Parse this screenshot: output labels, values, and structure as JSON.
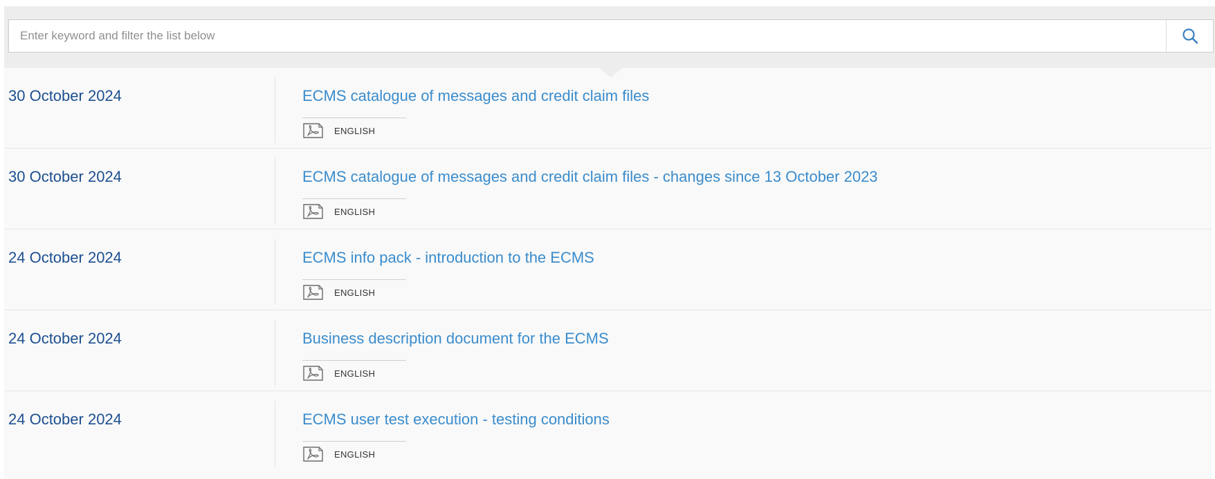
{
  "search": {
    "placeholder": "Enter keyword and filter the list below",
    "value": "",
    "button_icon": "search-icon"
  },
  "colors": {
    "date": "#1d4f91",
    "title_link": "#3a8ccc",
    "filter_background": "#ededed",
    "list_background": "#f9f9f9"
  },
  "documents": [
    {
      "date": "30 October 2024",
      "title": "ECMS catalogue of messages and credit claim files",
      "file_icon": "pdf-icon",
      "language": "ENGLISH"
    },
    {
      "date": "30 October 2024",
      "title": "ECMS catalogue of messages and credit claim files - changes since 13 October 2023",
      "file_icon": "pdf-icon",
      "language": "ENGLISH"
    },
    {
      "date": "24 October 2024",
      "title": "ECMS info pack - introduction to the ECMS",
      "file_icon": "pdf-icon",
      "language": "ENGLISH"
    },
    {
      "date": "24 October 2024",
      "title": "Business description document for the ECMS",
      "file_icon": "pdf-icon",
      "language": "ENGLISH"
    },
    {
      "date": "24 October 2024",
      "title": "ECMS user test execution - testing conditions",
      "file_icon": "pdf-icon",
      "language": "ENGLISH"
    }
  ]
}
